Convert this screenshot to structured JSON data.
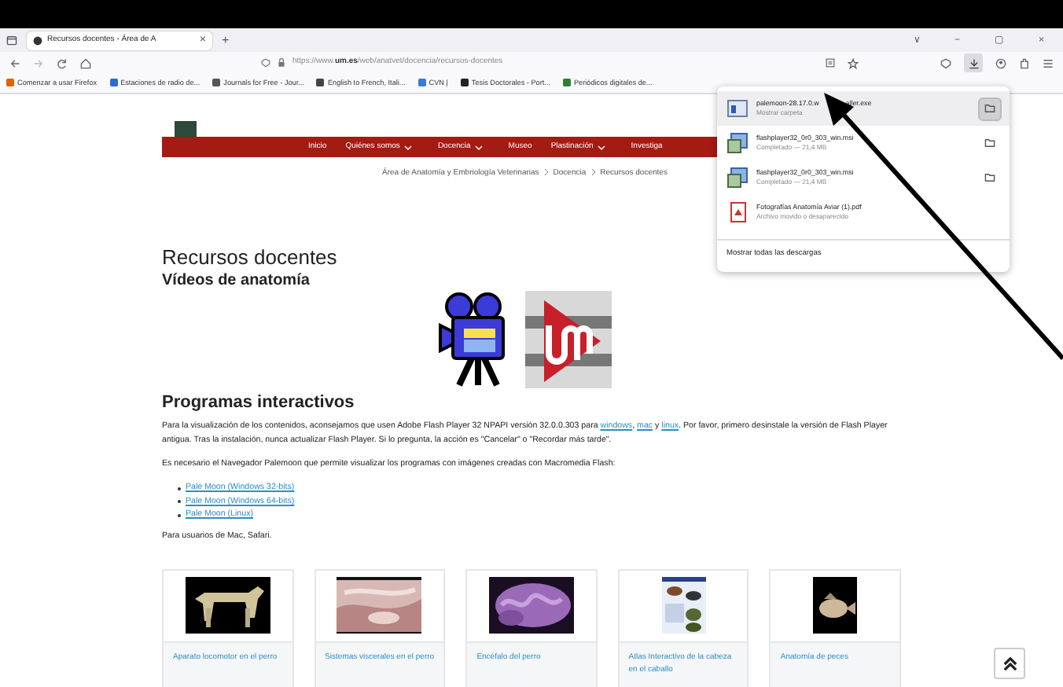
{
  "browser": {
    "tab": {
      "title": "Recursos docentes - Área de A",
      "selected": true,
      "close": "×"
    },
    "new_tab": "+",
    "window_buttons": [
      "∨",
      "−",
      "▢",
      "×"
    ],
    "url": {
      "host_prefix": "https://www.",
      "host": "um.es",
      "path": "/web/anatvet/docencia/recursos-docentes"
    },
    "bookmarks": [
      {
        "label": "Comenzar a usar Firefox",
        "color": "#e66000"
      },
      {
        "label": "Estaciones de radio de...",
        "color": "#2a6ad6"
      },
      {
        "label": "Journals for Free - Jour...",
        "color": "#555555"
      },
      {
        "label": "English to French, Itali...",
        "color": "#444444"
      },
      {
        "label": "CVN |",
        "color": "#3a7bd5"
      },
      {
        "label": "Tesis Doctorales - Port...",
        "color": "#222222"
      },
      {
        "label": "Periódicos digitales de...",
        "color": "#2e7d32"
      }
    ]
  },
  "site_nav": [
    {
      "label": "Inicio",
      "dropdown": false
    },
    {
      "label": "Quiénes somos",
      "dropdown": true
    },
    {
      "label": "Docencia",
      "dropdown": true
    },
    {
      "label": "Museo",
      "dropdown": false
    },
    {
      "label": "Plastinación",
      "dropdown": true
    },
    {
      "label": "Investiga",
      "dropdown": false
    }
  ],
  "breadcrumb": [
    "Área de Anatomía y Embriología Veterinarias",
    "Docencia",
    "Recursos docentes"
  ],
  "page_title": "Recursos docentes",
  "videos_heading": "Vídeos de anatomía",
  "programs_heading": "Programas interactivos",
  "intro": [
    {
      "text": "Para la visualización de los contenidos, aconsejamos que usen Adobe Flash Player 32 NPAPI versión 32.0.0.303 para ",
      "kind": "text"
    },
    {
      "text": "windows",
      "kind": "link"
    },
    {
      "text": ", ",
      "kind": "text"
    },
    {
      "text": "mac",
      "kind": "link"
    },
    {
      "text": " y ",
      "kind": "text"
    },
    {
      "text": "linux",
      "kind": "link"
    },
    {
      "text": ". Por favor, primero desinstale la versión de Flash Player antigua. Tras la instalación, nunca actualizar Flash Player. Si lo pregunta, la acción es \"Cancelar\" o \"Recordar más tarde\".",
      "kind": "text"
    }
  ],
  "browser_note": "Es necesario el Navegador Palemoon que permite visualizar los programas con imágenes creadas con Macromedia Flash:",
  "palemoon_links": [
    "Pale Moon (Windows 32-bits)",
    "Pale Moon (Windows 64-bits)",
    "Pale Moon (Linux)"
  ],
  "mac_note": "Para usuarios de Mac, Safari.",
  "cards": [
    {
      "title": "Aparato locomotor en el perro",
      "kind": "picture"
    },
    {
      "title": "Sistemas viscerales en el perro",
      "kind": "picture"
    },
    {
      "title": "Encéfalo del perro",
      "kind": "picture"
    },
    {
      "title": "Atlas Interactivo de la cabeza en el caballo",
      "kind": "picture"
    },
    {
      "title": "Anatomía de peces",
      "kind": "picture"
    }
  ],
  "downloads": {
    "items": [
      {
        "name": [
          "palemoon-28.17.0.w",
          "aller.exe"
        ],
        "status": "Mostrar carpeta",
        "kind": "exe",
        "hovered": true
      },
      {
        "name": [
          "flashplayer32_0r0_303_win.msi"
        ],
        "status": "Completado — 21,4 MB",
        "kind": "msi",
        "hovered": false
      },
      {
        "name": [
          "flashplayer32_0r0_303_win.msi"
        ],
        "status": "Completado — 21,4 MB",
        "kind": "msi",
        "hovered": false
      },
      {
        "name": [
          "Fotografías Anatomía Aviar (1).pdf"
        ],
        "status": "Archivo movido o desaparecido",
        "kind": "pdf",
        "hovered": false
      }
    ],
    "footer": "Mostrar todas las descargas"
  }
}
